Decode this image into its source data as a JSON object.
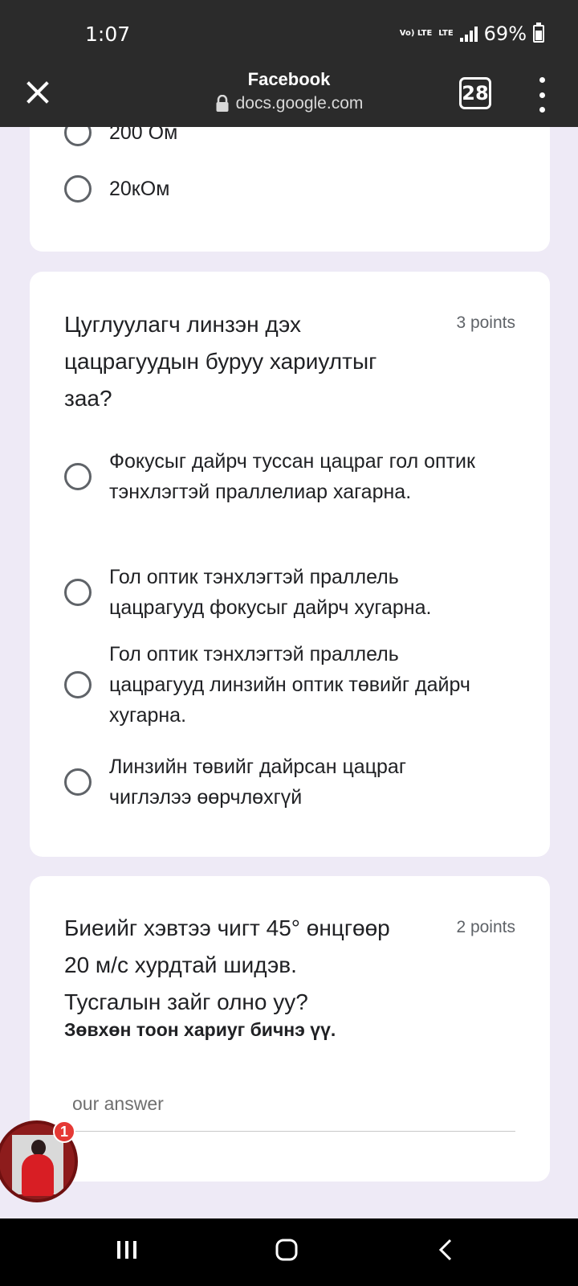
{
  "status": {
    "time": "1:07",
    "network_small_1": "Vo) LTE",
    "network_small_2": "LTE",
    "battery": "69%",
    "battery_level": 0.69
  },
  "browser": {
    "title": "Facebook",
    "url": "docs.google.com",
    "tab_count": "28"
  },
  "question1": {
    "options": [
      "200 Ом",
      "20кОм"
    ]
  },
  "question2": {
    "title": "Цуглуулагч линзэн дэх цацрагуудын буруу хариултыг заа?",
    "points": "3 points",
    "options": [
      "Фокусыг дайрч туссан цацраг гол оптик тэнхлэгтэй праллелиар хагарна.",
      "Гол оптик тэнхлэгтэй праллель цацрагууд фокусыг дайрч хугарна.",
      "Гол оптик тэнхлэгтэй праллель цацрагууд линзийн оптик төвийг дайрч хугарна.",
      "Линзийн төвийг дайрсан цацраг чиглэлээ өөрчлөхгүй"
    ]
  },
  "question3": {
    "title_line1": "Биеийг хэвтээ чигт 45° өнцгөөр",
    "title_line2": "20 м/с хурдтай шидэв.",
    "title_line3": "Тусгалын зайг олно уу?",
    "points": "2 points",
    "note": "Зөвхөн тоон хариуг бичнэ үү.",
    "answer_placeholder": "our answer"
  },
  "chat": {
    "badge_count": "1"
  },
  "colors": {
    "dark_chrome": "#2b2b2b",
    "page_bg": "#eeeaf6",
    "card_bg": "#ffffff",
    "text_primary": "#202124",
    "text_secondary": "#5f6368",
    "badge_red": "#e53935"
  },
  "icons": {
    "close": "close-icon",
    "lock": "lock-icon",
    "menu": "more-vert-icon",
    "recent_apps": "recent-apps-icon",
    "home": "home-icon",
    "back": "back-icon"
  }
}
